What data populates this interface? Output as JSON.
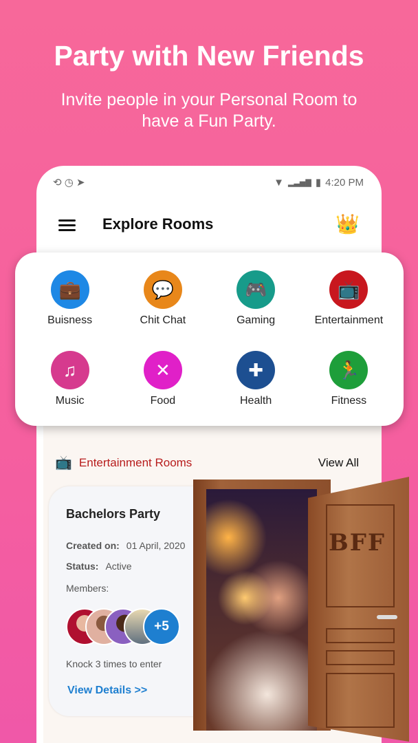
{
  "hero": {
    "title": "Party with New Friends",
    "subtitle": "Invite people in your Personal Room to have a Fun Party."
  },
  "status_bar": {
    "time": "4:20 PM",
    "icons": [
      "screen-rotation-lock-icon",
      "clock-icon",
      "location-arrow-icon",
      "wifi-icon",
      "signal-icon",
      "battery-icon"
    ]
  },
  "app_bar": {
    "title": "Explore Rooms",
    "menu_icon": "hamburger-icon",
    "premium_icon": "crown-icon"
  },
  "categories": [
    {
      "label": "Buisness",
      "icon": "briefcase-icon",
      "color": "#1E88E5"
    },
    {
      "label": "Chit Chat",
      "icon": "chat-bubble-icon",
      "color": "#E8871A"
    },
    {
      "label": "Gaming",
      "icon": "gamepad-icon",
      "color": "#179B8A"
    },
    {
      "label": "Entertainment",
      "icon": "tv-icon",
      "color": "#C8171E"
    },
    {
      "label": "Music",
      "icon": "music-note-icon",
      "color": "#D63A8E"
    },
    {
      "label": "Food",
      "icon": "fork-knife-icon",
      "color": "#E020C8"
    },
    {
      "label": "Health",
      "icon": "medical-cross-icon",
      "color": "#1D4F91"
    },
    {
      "label": "Fitness",
      "icon": "running-icon",
      "color": "#1E9E3A"
    }
  ],
  "section": {
    "title": "Entertainment Rooms",
    "view_all": "View All",
    "accent": "#B71C1C"
  },
  "room": {
    "name": "Bachelors Party",
    "created_label": "Created on:",
    "created_value": "01 April, 2020",
    "status_label": "Status:",
    "status_value": "Active",
    "members_label": "Members:",
    "more_members": "+5",
    "note": "Knock 3 times to enter",
    "details_link": "View Details >>"
  },
  "door": {
    "sign": "BFF"
  }
}
